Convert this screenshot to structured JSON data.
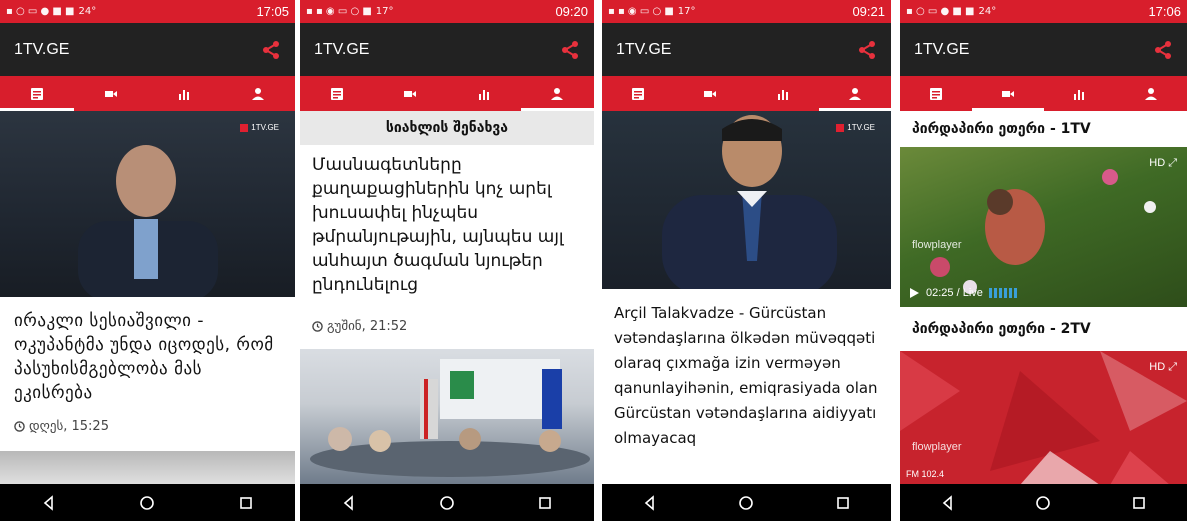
{
  "screens": [
    {
      "status_time": "17:05",
      "status_temp": "24°",
      "app_title": "1TV.GE",
      "active_tab": 0,
      "headline": "ირაკლი სესიაშვილი - ოკუპანტმა უნდა იცოდეს, რომ პასუხისმგებლობა მას ეკისრება",
      "meta": "დღეს, 15:25",
      "logo_text": "1TV.GE"
    },
    {
      "status_time": "09:20",
      "status_temp": "17°",
      "app_title": "1TV.GE",
      "active_tab": 3,
      "section_title": "სიახლის შენახვა",
      "headline": "Մասնագետները քաղաքացիներին կոչ արել խուսափել ինչպես թմրանյութային, այնպես այլ անհայտ ծագման նյութեր ընդունելուց",
      "meta": "გუშინ, 21:52"
    },
    {
      "status_time": "09:21",
      "status_temp": "17°",
      "app_title": "1TV.GE",
      "active_tab": 3,
      "headline": "Arçil Talakvadze - Gürcüstan vətəndaşlarına ölkədən müvəqqəti olaraq çıxmağa izin verməyən qanunlayihənin, emiqrasiyada olan Gürcüstan vətəndaşlarına aidiyyatı olmayacaq",
      "logo_text": "1TV.GE"
    },
    {
      "status_time": "17:06",
      "status_temp": "24°",
      "app_title": "1TV.GE",
      "active_tab": 1,
      "live1_title": "პირდაპირი ეთერი - 1TV",
      "live2_title": "პირდაპირი ეთერი - 2TV",
      "player_label": "flowplayer",
      "player2_label": "flowplayer",
      "time_display": "02:25 / Live",
      "fm_label": "FM 102.4"
    }
  ],
  "colors": {
    "brand_red": "#d81e2c",
    "appbar": "#222222",
    "navbar": "#000000"
  },
  "tab_icons": [
    "news-icon",
    "video-icon",
    "chart-icon",
    "profile-icon"
  ],
  "nav_icons": [
    "back-icon",
    "home-icon",
    "recents-icon"
  ]
}
